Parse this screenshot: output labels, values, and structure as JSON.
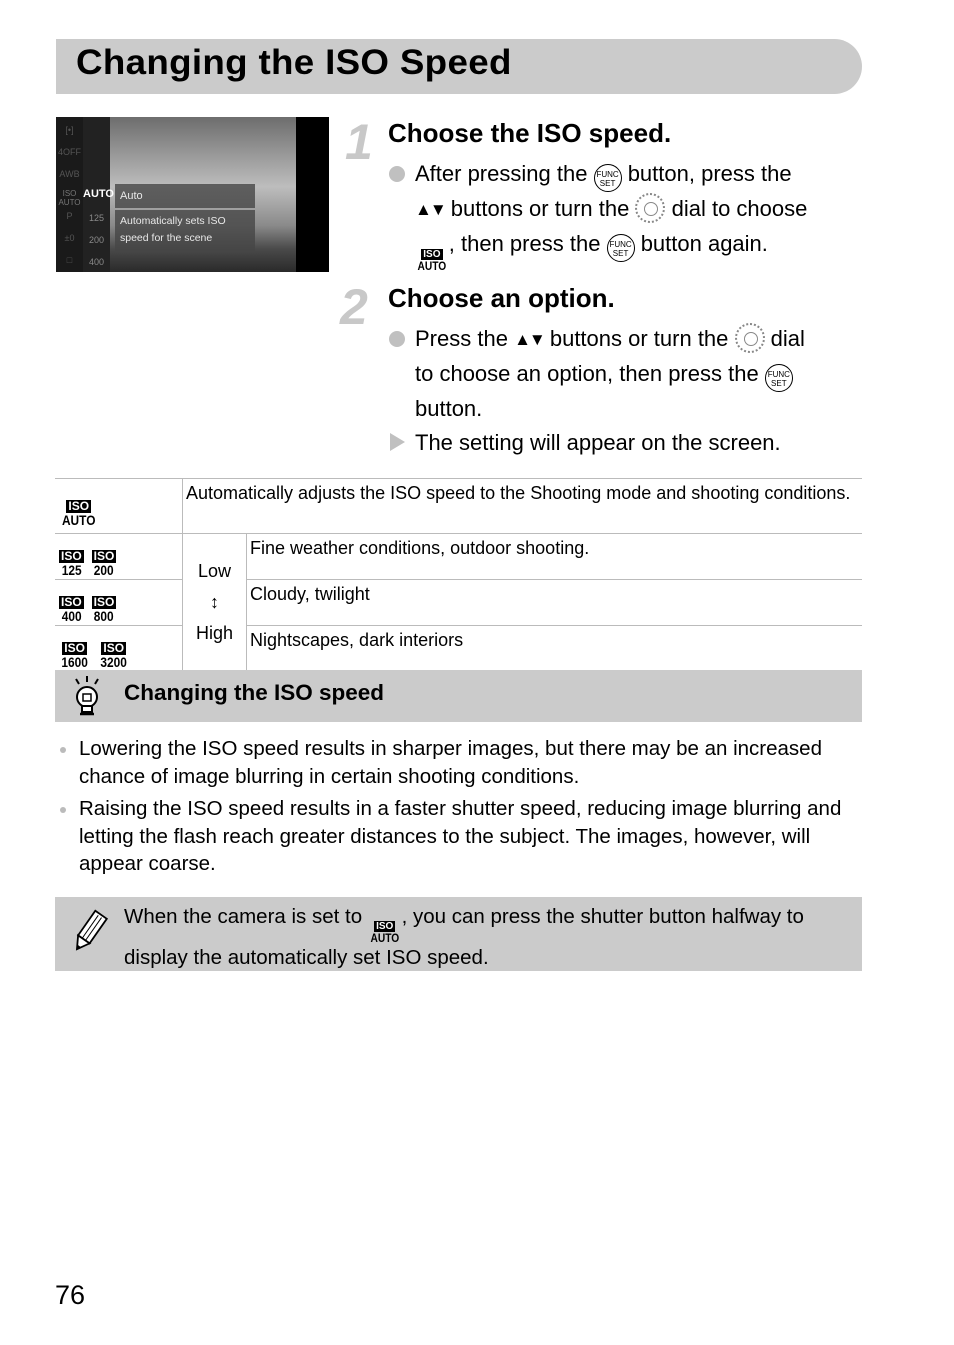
{
  "page_title": "Changing the ISO Speed",
  "camera_screen": {
    "side_icons": [
      "[•]",
      "4OFF",
      "AWB",
      "ISO AUTO",
      "P",
      "±0",
      "□"
    ],
    "values": [
      "AUTO",
      "125",
      "200",
      "400"
    ],
    "selected_label": "Auto",
    "description_line1": "Automatically sets ISO",
    "description_line2": "speed for the scene"
  },
  "steps": [
    {
      "number": "1",
      "title": "Choose the ISO speed.",
      "text_a": "After pressing the",
      "text_b": "button, press the",
      "text_c": "buttons or turn the",
      "text_d": "dial to choose",
      "text_e": ", then press the",
      "text_f": "button again."
    },
    {
      "number": "2",
      "title": "Choose an option.",
      "text_a": "Press the",
      "text_b": "buttons or turn the",
      "text_c": "dial",
      "text_d": "to choose an option, then press the",
      "text_e": "button.",
      "result": "The setting will appear on the screen."
    }
  ],
  "icons": {
    "func_top": "FUNC",
    "func_bottom": "SET",
    "iso_top": "ISO",
    "iso_auto": "AUTO",
    "arrows": "▲▼"
  },
  "iso_table": {
    "auto_row": {
      "icon": "AUTO",
      "description": "Automatically adjusts the ISO speed to the Shooting mode and shooting conditions."
    },
    "low_label": "Low",
    "arrow": "↕",
    "high_label": "High",
    "rows": [
      {
        "icons": [
          "125",
          "200"
        ],
        "description": "Fine weather conditions, outdoor shooting."
      },
      {
        "icons": [
          "400",
          "800"
        ],
        "description": "Cloudy, twilight"
      },
      {
        "icons": [
          "1600",
          "3200"
        ],
        "description": "Nightscapes, dark interiors"
      }
    ]
  },
  "tip": {
    "title": "Changing the ISO speed",
    "items": [
      "Lowering the ISO speed results in sharper images, but there may be an increased chance of image blurring in certain shooting conditions.",
      "Raising the ISO speed results in a faster shutter speed, reducing image blurring and letting the flash reach greater distances to the subject. The images, however, will appear coarse."
    ]
  },
  "note": {
    "text_a": "When the camera is set to",
    "text_b": ", you can press the shutter button halfway to display the automatically set ISO speed."
  },
  "page_number": "76"
}
